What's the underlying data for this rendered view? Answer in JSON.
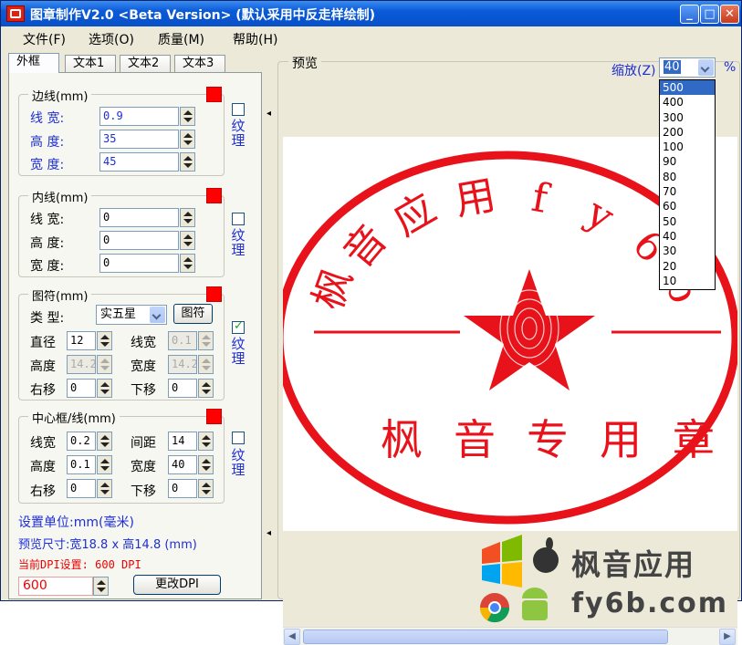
{
  "window": {
    "title": "图章制作V2.0 <Beta Version> (默认采用中反走样绘制)",
    "min_icon": "minimize-icon",
    "max_icon": "maximize-icon",
    "close_icon": "close-icon",
    "min": "_",
    "max": "□",
    "close": "✕"
  },
  "menu": [
    "文件(F)",
    "选项(O)",
    "质量(M)",
    "帮助(H)"
  ],
  "tabs": [
    "外框",
    "文本1",
    "文本2",
    "文本3"
  ],
  "border_group": {
    "legend": "边线(mm)",
    "line_width_label": "线  宽:",
    "height_label": "高  度:",
    "width_label": "宽  度:",
    "line_width": "0.9",
    "height": "35",
    "width": "45",
    "texture": "纹理",
    "texture_checked": false
  },
  "inner_group": {
    "legend": "内线(mm)",
    "line_width_label": "线  宽:",
    "height_label": "高  度:",
    "width_label": "宽  度:",
    "line_width": "0",
    "height": "0",
    "width": "0",
    "texture": "纹理",
    "texture_checked": false
  },
  "symbol_group": {
    "legend": "图符(mm)",
    "type_label": "类  型:",
    "type_value": "实五星",
    "symbol_button": "图符",
    "diameter_label": "直径",
    "diameter": "12",
    "linewidth_label": "线宽",
    "linewidth": "0.1",
    "height_label": "高度",
    "height": "14.2",
    "width_label": "宽度",
    "width": "14.2",
    "right_label": "右移",
    "right": "0",
    "down_label": "下移",
    "down": "0",
    "texture": "纹理",
    "texture_checked": true
  },
  "center_group": {
    "legend": "中心框/线(mm)",
    "linewidth_label": "线宽",
    "linewidth": "0.2",
    "spacing_label": "间距",
    "spacing": "14",
    "height_label": "高度",
    "height": "0.1",
    "width_label": "宽度",
    "width": "40",
    "right_label": "右移",
    "right": "0",
    "down_label": "下移",
    "down": "0",
    "texture": "纹理",
    "texture_checked": false
  },
  "footer": {
    "unit": "设置单位:mm(毫米)",
    "preview_size": "预览尺寸:宽18.8 x 高14.8 (mm)",
    "dpi_text": "当前DPI设置: 600 DPI",
    "dpi_value": "600",
    "change_dpi": "更改DPI"
  },
  "preview": {
    "legend": "预览",
    "zoom_label": "缩放(Z)",
    "zoom_value": "40",
    "percent": "%",
    "zoom_options": [
      "500",
      "400",
      "300",
      "200",
      "100",
      "90",
      "80",
      "70",
      "60",
      "50",
      "40",
      "30",
      "20",
      "10"
    ],
    "zoom_selected": "500"
  },
  "stamp": {
    "top_text": [
      "枫",
      "音",
      "应",
      "用",
      "f",
      "y",
      "6",
      "b"
    ],
    "bottom_text": [
      "枫",
      "音",
      "专",
      "用",
      "章"
    ],
    "color": "#e8121a"
  },
  "watermark": {
    "line1": "枫音应用",
    "line2": "fy6b.com"
  },
  "colors": {
    "stamp_red": "#e8121a",
    "title_blue": "#0a5ad8"
  }
}
